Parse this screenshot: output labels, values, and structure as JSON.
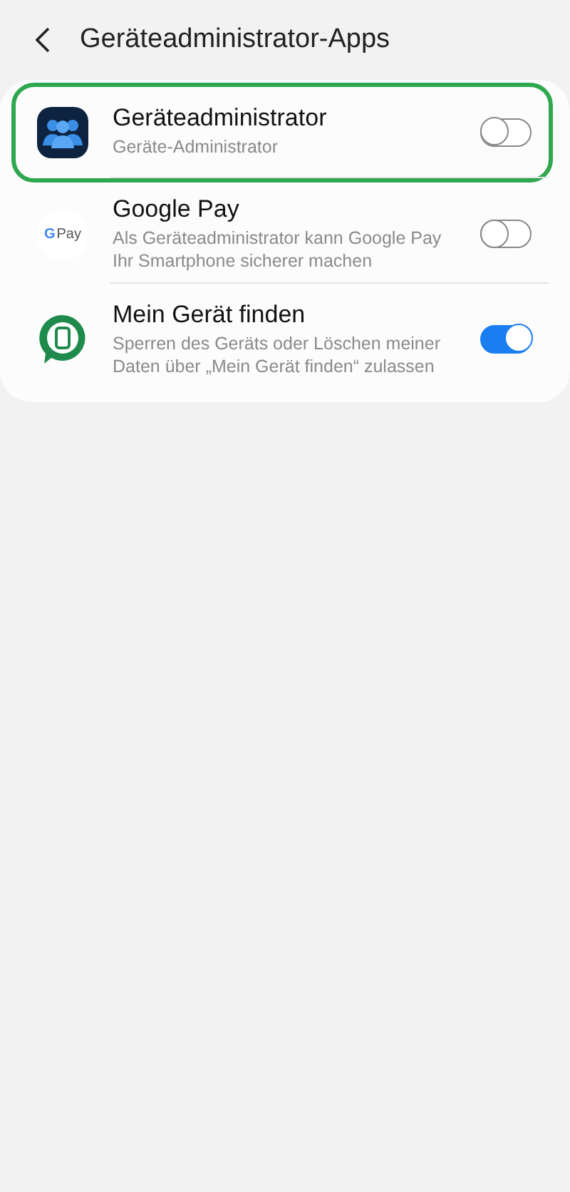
{
  "header": {
    "title": "Geräteadministrator-Apps"
  },
  "apps": [
    {
      "kind": "admin",
      "title": "Geräteadministrator",
      "subtitle": "Geräte-Administrator",
      "on": false,
      "highlighted": true
    },
    {
      "kind": "gpay",
      "icon_text": "Pay",
      "icon_letter": "G",
      "title": "Google Pay",
      "subtitle": "Als Geräteadministrator kann Google Pay Ihr Smartphone sicherer machen",
      "on": false,
      "highlighted": false
    },
    {
      "kind": "find",
      "title": "Mein Gerät finden",
      "subtitle": "Sperren des Geräts oder Löschen meiner Daten über „Mein Gerät finden“ zulassen",
      "on": true,
      "highlighted": false
    }
  ]
}
